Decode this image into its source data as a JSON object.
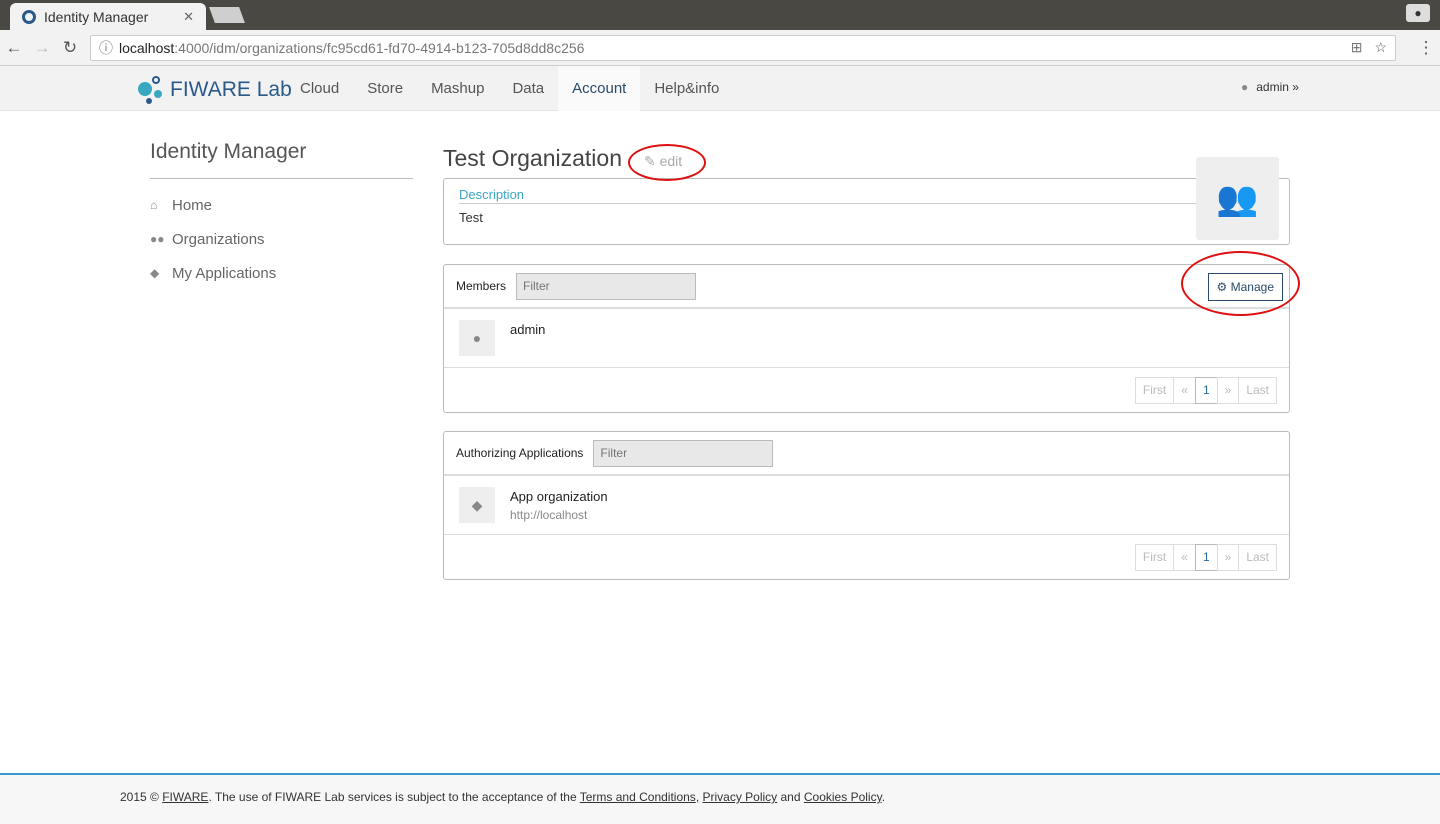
{
  "browser": {
    "tab_title": "Identity Manager",
    "url_host": "localhost",
    "url_path": ":4000/idm/organizations/fc95cd61-fd70-4914-b123-705d8dd8c256"
  },
  "header": {
    "logo": "FIWARE Lab",
    "nav": [
      "Cloud",
      "Store",
      "Mashup",
      "Data",
      "Account",
      "Help&info"
    ],
    "user": "admin"
  },
  "sidebar": {
    "title": "Identity Manager",
    "items": [
      {
        "label": "Home"
      },
      {
        "label": "Organizations"
      },
      {
        "label": "My Applications"
      }
    ]
  },
  "org": {
    "name": "Test Organization",
    "edit_label": "edit",
    "description_label": "Description",
    "description": "Test"
  },
  "members": {
    "label": "Members",
    "filter_placeholder": "Filter",
    "manage_label": "Manage",
    "items": [
      {
        "name": "admin"
      }
    ]
  },
  "apps": {
    "label": "Authorizing Applications",
    "filter_placeholder": "Filter",
    "items": [
      {
        "name": "App organization",
        "url": "http://localhost"
      }
    ]
  },
  "pager": {
    "first": "First",
    "prev": "«",
    "page": "1",
    "next": "»",
    "last": "Last"
  },
  "footer": {
    "prefix": "2015 © ",
    "fiware": "FIWARE",
    "text1": ". The use of FIWARE Lab services is subject to the acceptance of the ",
    "terms": "Terms and Conditions",
    "sep": ", ",
    "privacy": "Privacy Policy",
    "and": " and ",
    "cookies": "Cookies Policy",
    "end": "."
  }
}
